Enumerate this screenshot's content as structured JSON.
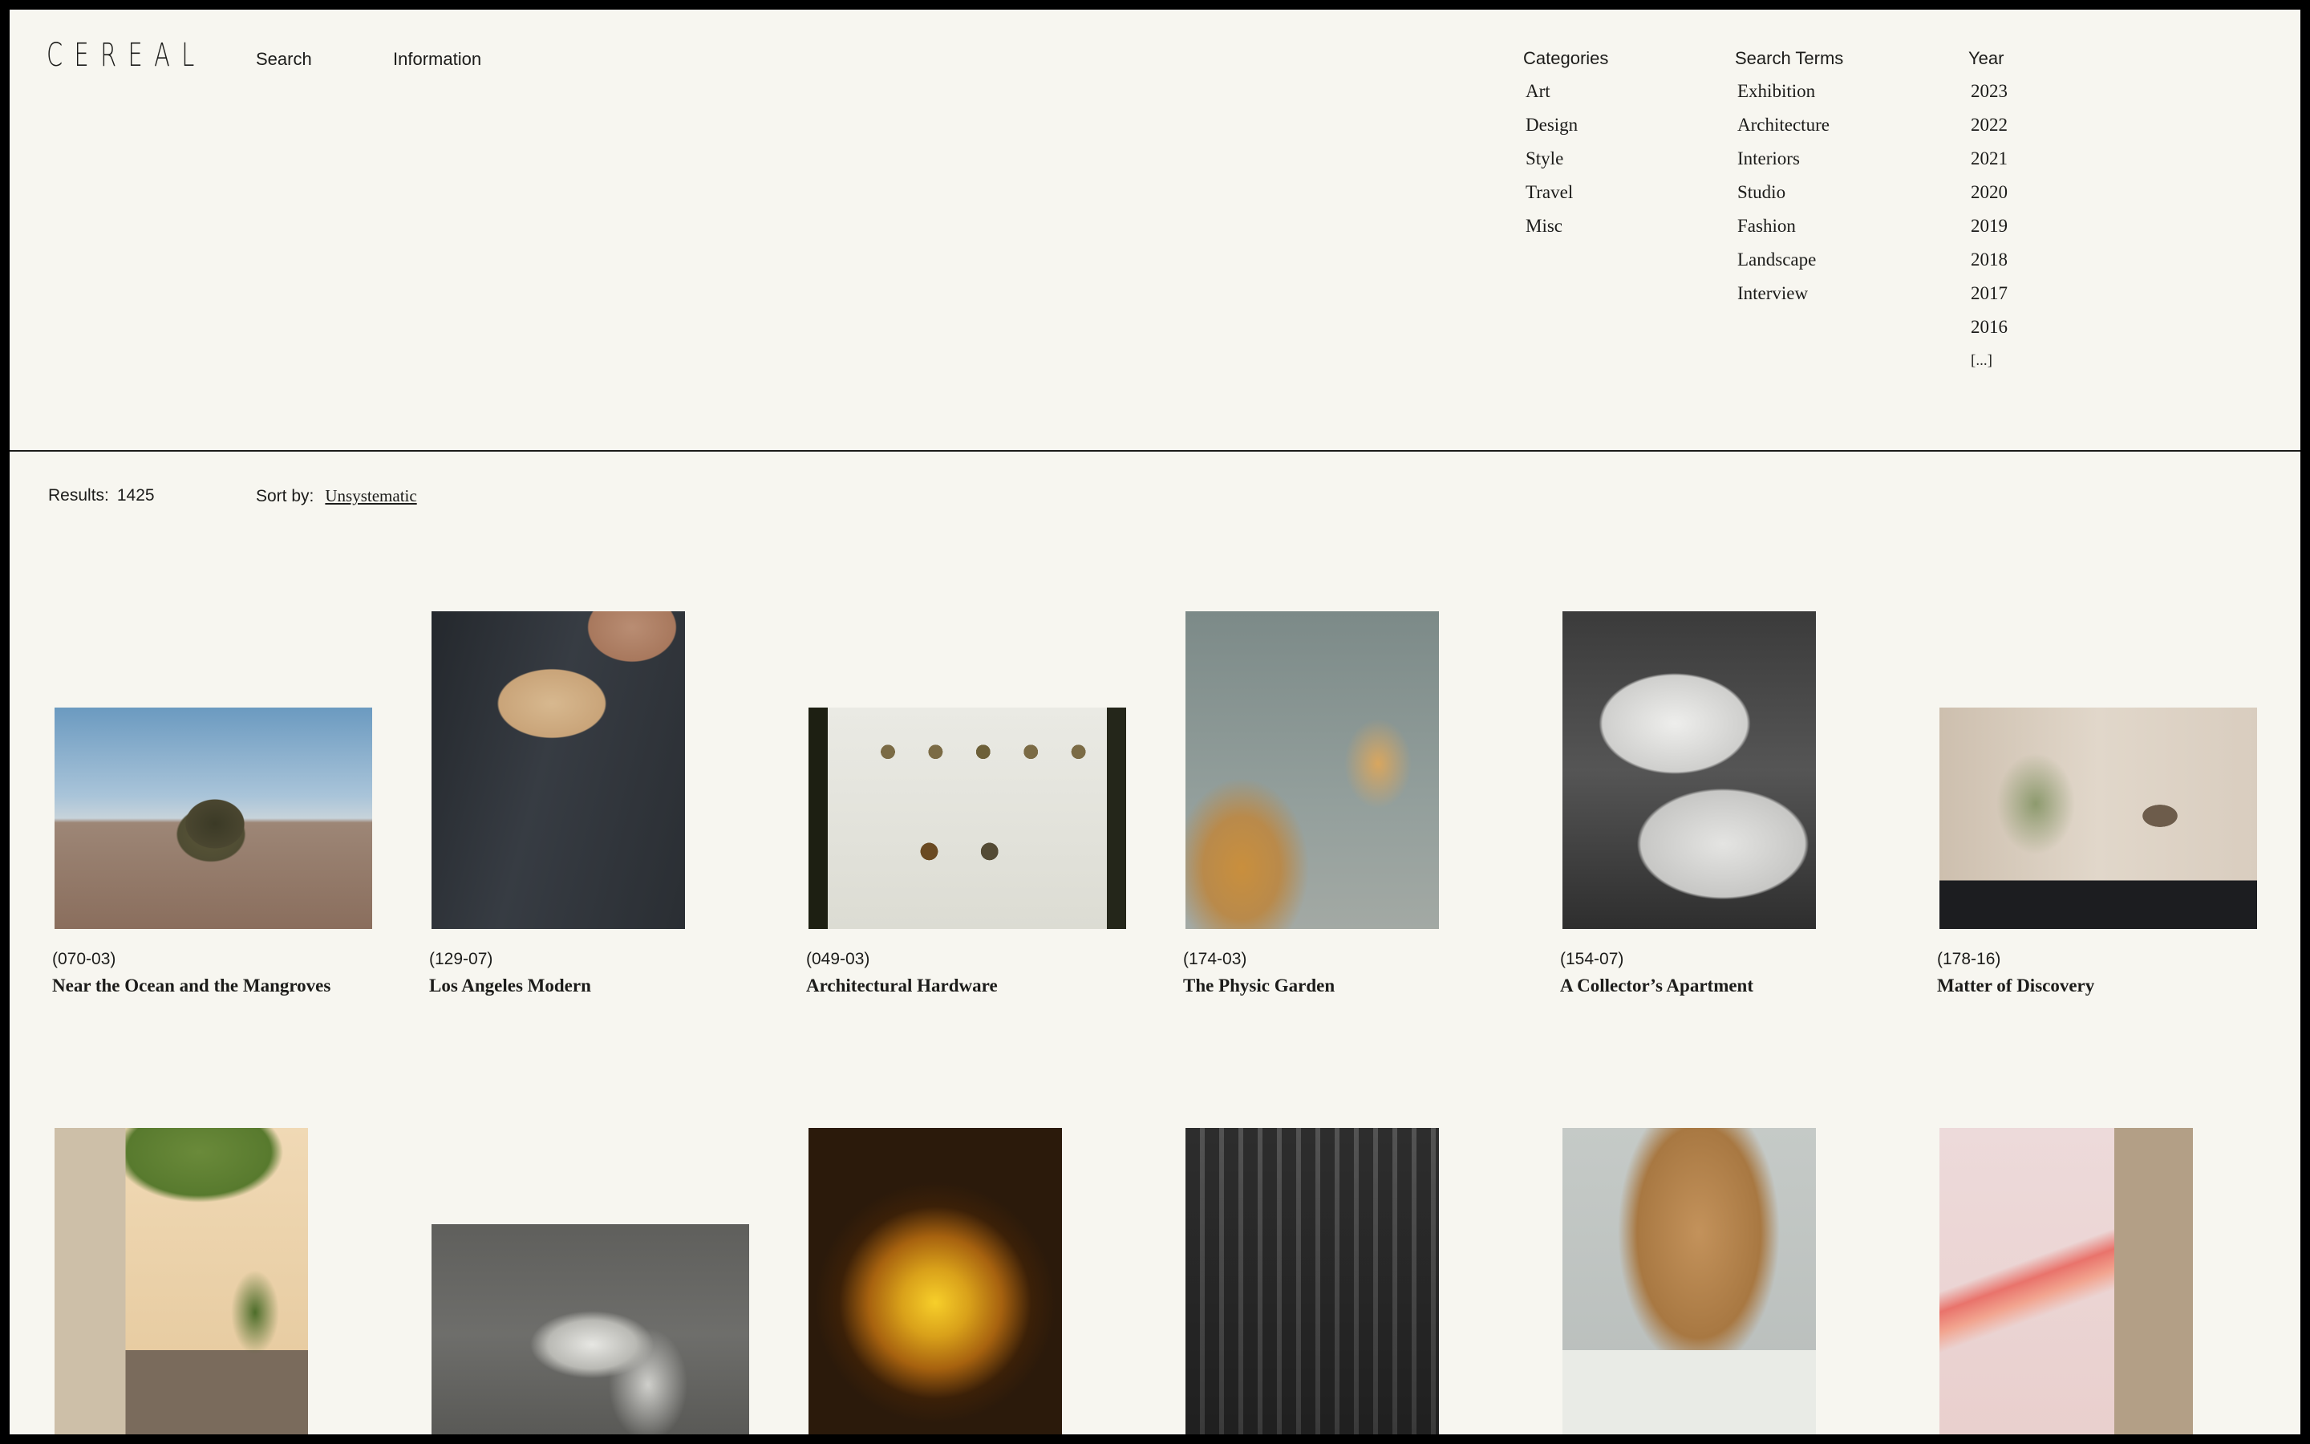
{
  "brand": {
    "logo": "CEREAL"
  },
  "nav": {
    "search": "Search",
    "information": "Information"
  },
  "filters": {
    "categories": {
      "heading": "Categories",
      "items": [
        "Art",
        "Design",
        "Style",
        "Travel",
        "Misc"
      ]
    },
    "search_terms": {
      "heading": "Search Terms",
      "items": [
        "Exhibition",
        "Architecture",
        "Interiors",
        "Studio",
        "Fashion",
        "Landscape",
        "Interview"
      ]
    },
    "year": {
      "heading": "Year",
      "items": [
        "2023",
        "2022",
        "2021",
        "2020",
        "2019",
        "2018",
        "2017",
        "2016",
        "[...]"
      ]
    }
  },
  "toolbar": {
    "results_label": "Results:",
    "results_count": "1425",
    "sort_label": "Sort by:",
    "sort_value": "Unsystematic"
  },
  "articles": [
    {
      "code": "(070-03)",
      "title": "Near the Ocean and the Mangroves",
      "image": "ocean-tree"
    },
    {
      "code": "(129-07)",
      "title": "Los Angeles Modern",
      "image": "shearling-jacket"
    },
    {
      "code": "(049-03)",
      "title": "Architectural Hardware",
      "image": "hardware-board"
    },
    {
      "code": "(174-03)",
      "title": "The Physic Garden",
      "image": "dried-flowers"
    },
    {
      "code": "(154-07)",
      "title": "A Collector’s Apartment",
      "image": "white-chairs"
    },
    {
      "code": "(178-16)",
      "title": "Matter of Discovery",
      "image": "lamp-interior"
    },
    {
      "image": "courtyard-bench"
    },
    {
      "image": "marble-statue"
    },
    {
      "image": "golden-orb"
    },
    {
      "image": "cafe-interior"
    },
    {
      "image": "satin-blouse"
    },
    {
      "image": "pink-abstract"
    }
  ]
}
